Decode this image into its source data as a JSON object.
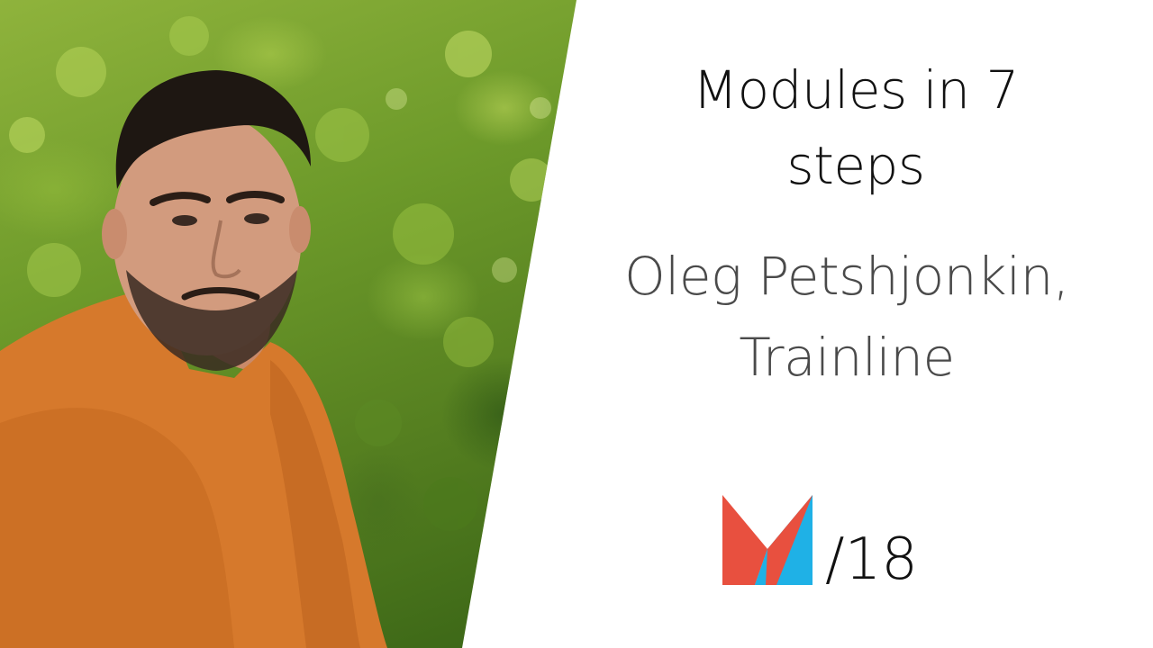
{
  "slide": {
    "title_line1": "Modules in 7",
    "title_line2": "steps",
    "speaker_line1": "Oleg Petshjonkin,",
    "speaker_line2": "Trainline",
    "edition": "/18"
  },
  "photo": {
    "icon": "speaker-photo"
  },
  "logo": {
    "icon": "conference-m-logo",
    "colors": {
      "red": "#e8503f",
      "blue": "#1fb1e6"
    }
  },
  "colors": {
    "background": "#ffffff",
    "title": "#111111",
    "speaker": "#4a4a4a"
  }
}
